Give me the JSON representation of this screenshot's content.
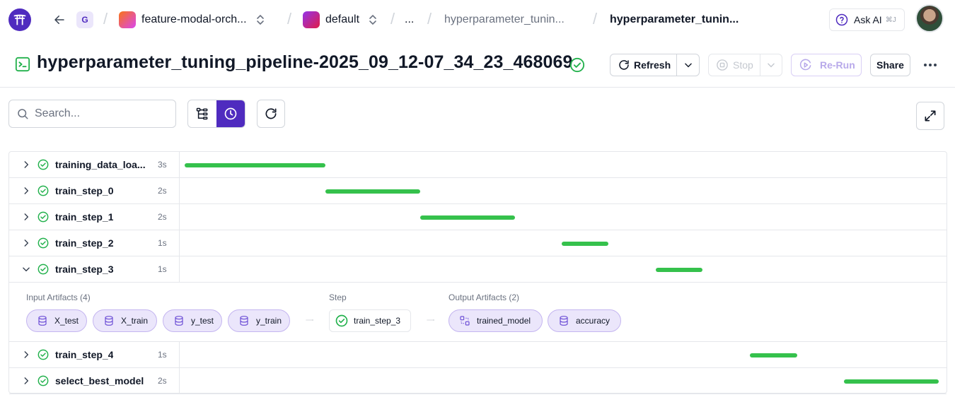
{
  "topnav": {
    "workspace_badge": "G",
    "project": {
      "name": "feature-modal-orch...",
      "color_from": "#f97316",
      "color_to": "#d946ef"
    },
    "stack": {
      "name": "default",
      "color_from": "#9333ea",
      "color_to": "#e11d48"
    },
    "ellipsis": "...",
    "pipeline": "hyperparameter_tunin...",
    "run": "hyperparameter_tunin...",
    "ask_ai": {
      "label": "Ask AI",
      "shortcut": "⌘J"
    }
  },
  "header": {
    "title": "hyperparameter_tuning_pipeline-2025_09_12-07_34_23_468069",
    "status": "completed",
    "refresh_label": "Refresh",
    "stop_label": "Stop",
    "rerun_label": "Re-Run",
    "share_label": "Share"
  },
  "toolbar": {
    "search_placeholder": "Search...",
    "view_modes": [
      "dag-view",
      "timeline-view"
    ],
    "active_view": "timeline-view"
  },
  "timeline": {
    "steps": [
      {
        "name": "training_data_loa...",
        "duration": "3s",
        "expanded": false,
        "bar_start": 0.0,
        "bar_end": 0.186
      },
      {
        "name": "train_step_0",
        "duration": "2s",
        "expanded": false,
        "bar_start": 0.186,
        "bar_end": 0.311
      },
      {
        "name": "train_step_1",
        "duration": "2s",
        "expanded": false,
        "bar_start": 0.311,
        "bar_end": 0.436
      },
      {
        "name": "train_step_2",
        "duration": "1s",
        "expanded": false,
        "bar_start": 0.498,
        "bar_end": 0.56
      },
      {
        "name": "train_step_3",
        "duration": "1s",
        "expanded": true,
        "bar_start": 0.622,
        "bar_end": 0.684
      },
      {
        "name": "train_step_4",
        "duration": "1s",
        "expanded": false,
        "bar_start": 0.747,
        "bar_end": 0.809
      },
      {
        "name": "select_best_model",
        "duration": "2s",
        "expanded": false,
        "bar_start": 0.871,
        "bar_end": 0.996
      }
    ],
    "detail": {
      "input_label": "Input Artifacts (4)",
      "inputs": [
        "X_test",
        "X_train",
        "y_test",
        "y_train"
      ],
      "step_label": "Step",
      "step_name": "train_step_3",
      "output_label": "Output Artifacts (2)",
      "outputs": [
        {
          "name": "trained_model",
          "icon": "model-icon"
        },
        {
          "name": "accuracy",
          "icon": "database-icon"
        }
      ]
    },
    "bar_color": "#35c14c"
  },
  "colors": {
    "accent": "#4f2bbf",
    "success": "#22b14c"
  }
}
